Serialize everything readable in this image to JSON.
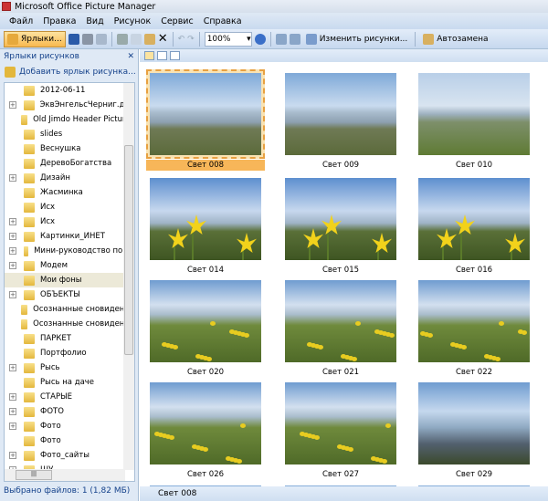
{
  "window": {
    "title": "Microsoft Office Picture Manager"
  },
  "menu": [
    "Файл",
    "Правка",
    "Вид",
    "Рисунок",
    "Сервис",
    "Справка"
  ],
  "toolbar": {
    "shortcuts_label": "Ярлыки...",
    "zoom": "100%",
    "edit_pictures_label": "Изменить рисунки...",
    "autocorrect_label": "Автозамена"
  },
  "panel": {
    "title": "Ярлыки рисунков",
    "add_shortcut": "Добавить ярлык рисунка...",
    "status": "Выбрано файлов: 1 (1,82 МБ)",
    "items": [
      {
        "label": "2012-06-11",
        "expandable": false
      },
      {
        "label": "ЭквЭнгельсЧерниг.див",
        "expandable": true
      },
      {
        "label": "Old Jimdo Header Pictures",
        "expandable": false
      },
      {
        "label": "slides",
        "expandable": false
      },
      {
        "label": "Веснушка",
        "expandable": false
      },
      {
        "label": "ДеревоБогатства",
        "expandable": false
      },
      {
        "label": "Дизайн",
        "expandable": true
      },
      {
        "label": "Жасминка",
        "expandable": false
      },
      {
        "label": "Исх",
        "expandable": false
      },
      {
        "label": "Исх",
        "expandable": true
      },
      {
        "label": "Картинки_ИНЕТ",
        "expandable": true
      },
      {
        "label": "Мини-руководство по из",
        "expandable": true
      },
      {
        "label": "Модем",
        "expandable": true
      },
      {
        "label": "Мои фоны",
        "expandable": false,
        "selected": true
      },
      {
        "label": "ОБЪЕКТЫ",
        "expandable": true
      },
      {
        "label": "Осознанные сновидения",
        "expandable": false
      },
      {
        "label": "Осознанные сновидения",
        "expandable": false
      },
      {
        "label": "ПАРКЕТ",
        "expandable": false
      },
      {
        "label": "Портфолио",
        "expandable": false
      },
      {
        "label": "Рысь",
        "expandable": true
      },
      {
        "label": "Рысь на даче",
        "expandable": false
      },
      {
        "label": "СТАРЫЕ",
        "expandable": true
      },
      {
        "label": "ФОТО",
        "expandable": true
      },
      {
        "label": "Фото",
        "expandable": true
      },
      {
        "label": "Фото",
        "expandable": false
      },
      {
        "label": "Фото_сайты",
        "expandable": true
      },
      {
        "label": "ШУ",
        "expandable": true
      }
    ]
  },
  "thumbnails": [
    {
      "name": "Свет 008",
      "selected": true,
      "kind": "shore"
    },
    {
      "name": "Свет 009",
      "kind": "shore"
    },
    {
      "name": "Свет 010",
      "kind": "field"
    },
    {
      "name": "Свет 014",
      "kind": "tulip"
    },
    {
      "name": "Свет 015",
      "kind": "tulip"
    },
    {
      "name": "Свет 016",
      "kind": "tulip"
    },
    {
      "name": "Свет 020",
      "kind": "meadow"
    },
    {
      "name": "Свет 021",
      "kind": "meadow"
    },
    {
      "name": "Свет 022",
      "kind": "meadow"
    },
    {
      "name": "Свет 026",
      "kind": "meadow"
    },
    {
      "name": "Свет 027",
      "kind": "meadow"
    },
    {
      "name": "Свет 029",
      "kind": "river"
    },
    {
      "name": "",
      "kind": "shore"
    },
    {
      "name": "",
      "kind": "shore"
    },
    {
      "name": "",
      "kind": "shore"
    }
  ],
  "statusbar": {
    "current": "Свет 008"
  }
}
